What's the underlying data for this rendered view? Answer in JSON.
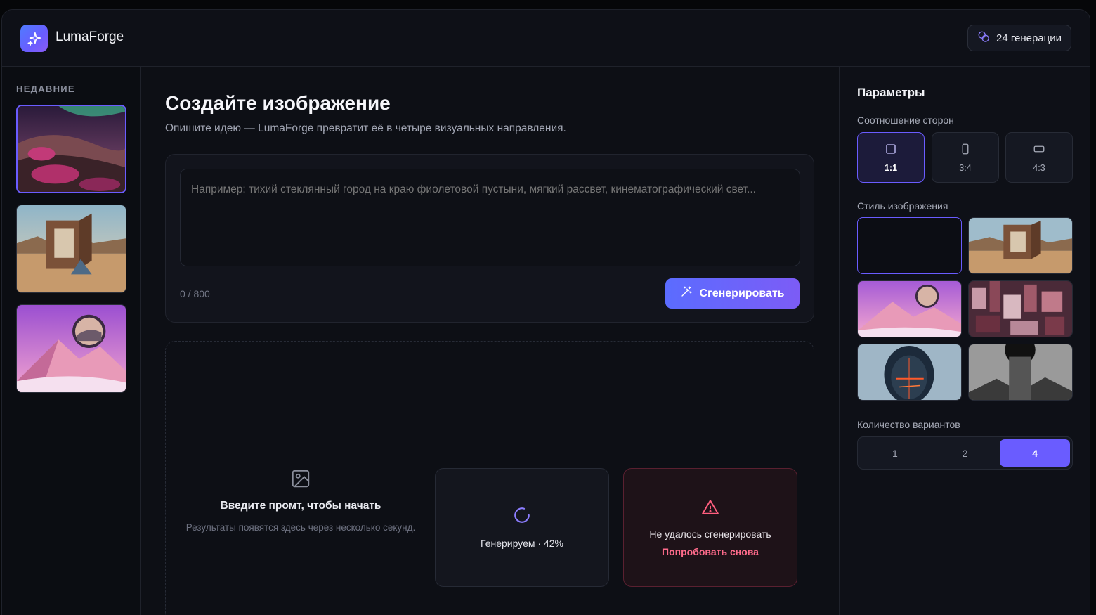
{
  "header": {
    "app_name": "LumaForge",
    "credits_label": "24 генерации"
  },
  "sidebar": {
    "title": "НЕДАВНИЕ",
    "recent": [
      "aurora-dunes",
      "desert-mirror-cube",
      "pink-mountain-orb"
    ]
  },
  "main": {
    "title": "Создайте изображение",
    "subtitle": "Опишите идею — LumaForge превратит её в четыре визуальных направления.",
    "prompt": {
      "value": "",
      "placeholder": "Например: тихий стеклянный город на краю фиолетовой пустыни, мягкий рассвет, кинематографический свет...",
      "char_count": "0 / 800"
    },
    "generate_label": "Сгенерировать",
    "empty_state": {
      "title": "Введите промт, чтобы начать",
      "description": "Результаты появятся здесь через несколько секунд."
    },
    "loading": {
      "text": "Генерируем · 42%",
      "progress": 42
    },
    "error": {
      "text": "Не удалось сгенерировать",
      "retry_label": "Попробовать снова"
    }
  },
  "params": {
    "title": "Параметры",
    "aspect_label": "Соотношение сторон",
    "aspect_ratios": [
      {
        "label": "1:1",
        "active": true
      },
      {
        "label": "3:4",
        "active": false
      },
      {
        "label": "4:3",
        "active": false
      }
    ],
    "style_label": "Стиль изображения",
    "count_label": "Количество вариантов",
    "counts": [
      {
        "label": "1",
        "active": false
      },
      {
        "label": "2",
        "active": false
      },
      {
        "label": "4",
        "active": true
      }
    ]
  },
  "colors": {
    "accent": "#6a5cff",
    "error": "#ff6b8b",
    "background": "#0d0f15"
  }
}
